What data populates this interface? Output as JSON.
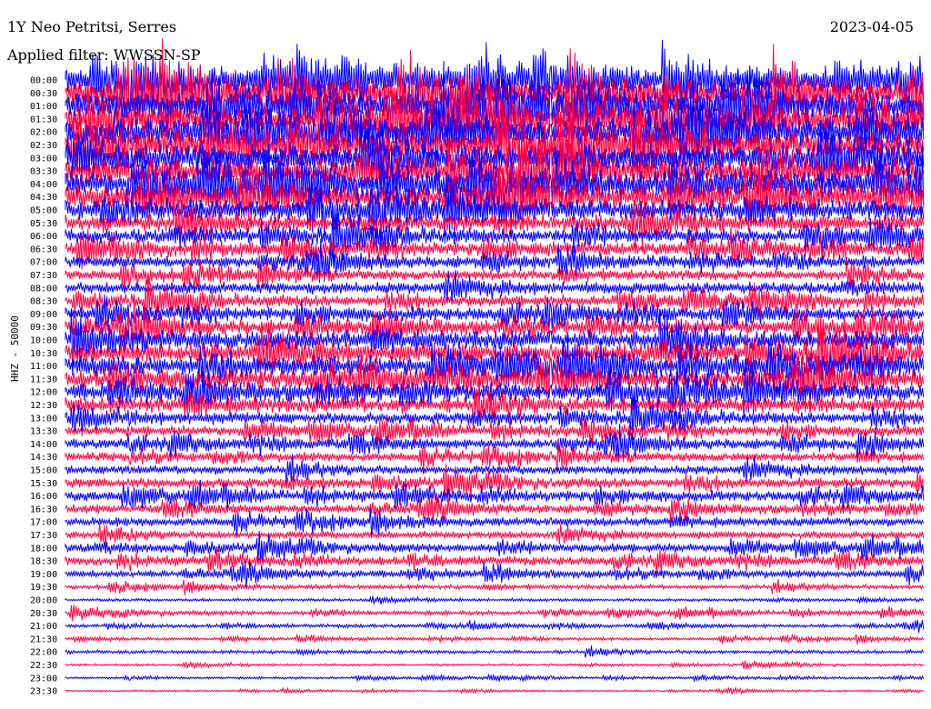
{
  "header": {
    "station": "1Y Neo Petritsi, Serres",
    "date": "2023-04-05",
    "filter": "Applied filter: WWSSN-SP"
  },
  "channel_label": "HHZ - 50000",
  "colors": {
    "even": "#0000ff",
    "odd": "#ff0040"
  },
  "chart_data": {
    "type": "line",
    "title": "1Y Neo Petritsi, Serres",
    "subtitle": "Applied filter: WWSSN-SP",
    "ylabel": "HHZ - 50000",
    "xlabel": "",
    "rows": [
      "00:00",
      "00:30",
      "01:00",
      "01:30",
      "02:00",
      "02:30",
      "03:00",
      "03:30",
      "04:00",
      "04:30",
      "05:00",
      "05:30",
      "06:00",
      "06:30",
      "07:00",
      "07:30",
      "08:00",
      "08:30",
      "09:00",
      "09:30",
      "10:00",
      "10:30",
      "11:00",
      "11:30",
      "12:00",
      "12:30",
      "13:00",
      "13:30",
      "14:00",
      "14:30",
      "15:00",
      "15:30",
      "16:00",
      "16:30",
      "17:00",
      "17:30",
      "18:00",
      "18:30",
      "19:00",
      "19:30",
      "20:00",
      "20:30",
      "21:00",
      "21:30",
      "22:00",
      "22:30",
      "23:00",
      "23:30"
    ],
    "relative_amplitude": [
      0.9,
      1.0,
      1.0,
      1.0,
      1.0,
      1.0,
      1.0,
      0.95,
      0.9,
      0.85,
      0.7,
      0.6,
      0.5,
      0.45,
      0.4,
      0.35,
      0.4,
      0.4,
      0.45,
      0.5,
      0.65,
      0.7,
      0.7,
      0.65,
      0.6,
      0.55,
      0.4,
      0.35,
      0.35,
      0.3,
      0.3,
      0.35,
      0.35,
      0.3,
      0.3,
      0.25,
      0.3,
      0.3,
      0.25,
      0.15,
      0.1,
      0.15,
      0.12,
      0.1,
      0.12,
      0.08,
      0.08,
      0.06
    ],
    "grid": false,
    "legend": "none"
  }
}
